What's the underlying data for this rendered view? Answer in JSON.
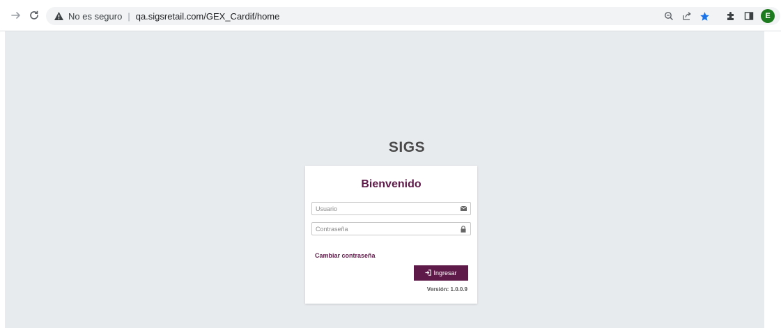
{
  "browser": {
    "security_label": "No es seguro",
    "url": "qa.sigsretail.com/GEX_Cardif/home",
    "profile_initial": "E",
    "icons": {
      "back": "arrow-right-icon",
      "reload": "reload-icon",
      "warning": "warning-icon",
      "zoom": "zoom-icon",
      "share": "share-icon",
      "bookmark": "star-icon",
      "extensions": "puzzle-icon",
      "side_panel": "side-panel-icon"
    },
    "colors": {
      "bookmark_star": "#1a73e8",
      "profile_bg": "#1e7a1e"
    }
  },
  "page": {
    "brand": "SIGS",
    "card": {
      "title": "Bienvenido",
      "username_placeholder": "Usuario",
      "password_placeholder": "Contraseña",
      "change_password_label": "Cambiar contraseña",
      "login_label": "Ingresar",
      "version": "Versión: 1.0.0.9"
    },
    "colors": {
      "accent": "#5e1a48",
      "background": "#e8ebee"
    }
  }
}
